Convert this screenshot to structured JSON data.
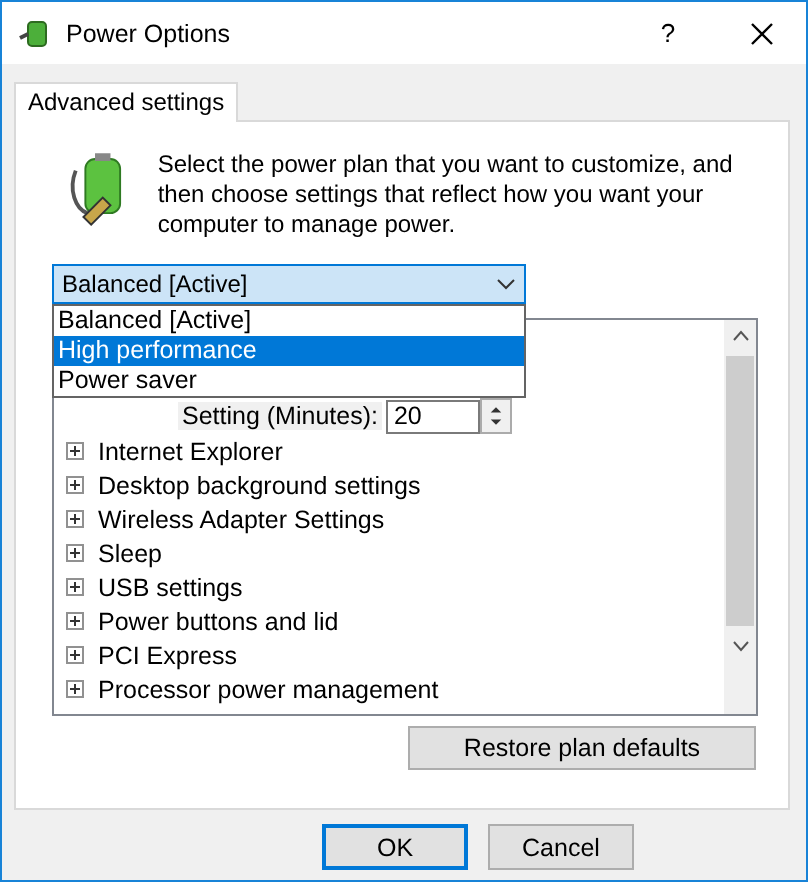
{
  "window": {
    "title": "Power Options",
    "help": "?"
  },
  "tabs": [
    {
      "label": "Advanced settings",
      "selected": true
    }
  ],
  "intro": "Select the power plan that you want to customize, and then choose settings that reflect how you want your computer to manage power.",
  "plan": {
    "value": "Balanced [Active]",
    "expanded": true,
    "options": [
      {
        "label": "Balanced [Active]",
        "highlighted": false
      },
      {
        "label": "High performance",
        "highlighted": true
      },
      {
        "label": "Power saver",
        "highlighted": false
      }
    ]
  },
  "settings": {
    "setting_label": "Setting (Minutes):",
    "setting_value": "20",
    "items": [
      {
        "label": "Internet Explorer",
        "expanded": false
      },
      {
        "label": "Desktop background settings",
        "expanded": false
      },
      {
        "label": "Wireless Adapter Settings",
        "expanded": false
      },
      {
        "label": "Sleep",
        "expanded": false
      },
      {
        "label": "USB settings",
        "expanded": false
      },
      {
        "label": "Power buttons and lid",
        "expanded": false
      },
      {
        "label": "PCI Express",
        "expanded": false
      },
      {
        "label": "Processor power management",
        "expanded": false
      }
    ]
  },
  "restore_button": "Restore plan defaults",
  "buttons": [
    {
      "label": "OK",
      "default": true
    },
    {
      "label": "Cancel",
      "default": false
    }
  ]
}
